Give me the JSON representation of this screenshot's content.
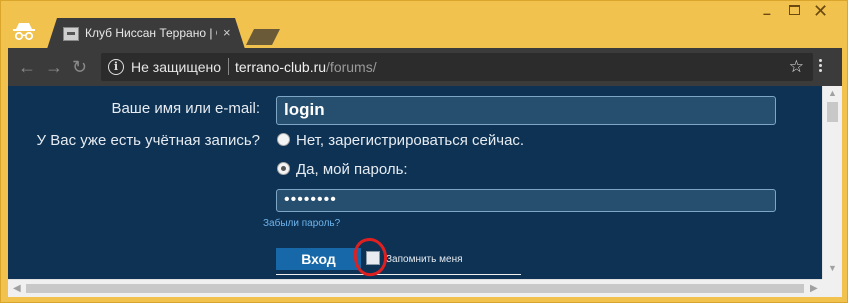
{
  "browser": {
    "tab_title": "Клуб Ниссан Террано | С",
    "tab_close": "×",
    "security_label": "Не защищено",
    "url_host": "terrano-club.ru",
    "url_path": "/forums/"
  },
  "form": {
    "username_label": "Ваше имя или e-mail:",
    "username_value": "login",
    "account_question": "У Вас уже есть учётная запись?",
    "option_register": "Нет, зарегистрироваться сейчас.",
    "option_password": "Да, мой пароль:",
    "option_register_checked": false,
    "option_password_checked": true,
    "password_value": "••••••••",
    "forgot_password": "Забыли пароль?",
    "login_button": "Вход",
    "remember_label": "Запомнить меня",
    "remember_checked": false
  },
  "colors": {
    "page_background": "#0e3254",
    "accent_button": "#1668a8",
    "link": "#6eb4ec",
    "annotation": "#e02020",
    "window_frame": "#f2c24e"
  },
  "icons": [
    "incognito-icon",
    "favicon-icon",
    "back-icon",
    "forward-icon",
    "reload-icon",
    "info-icon",
    "star-icon",
    "menu-icon"
  ]
}
